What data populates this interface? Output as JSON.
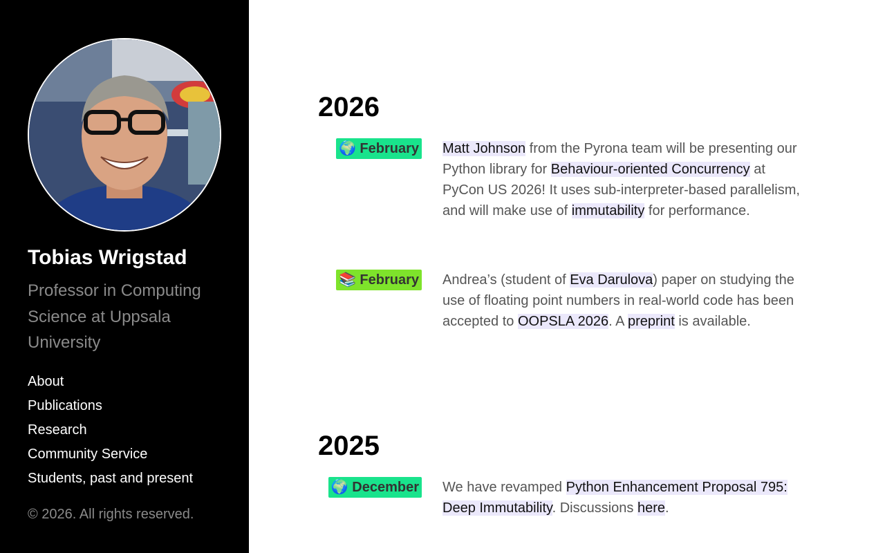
{
  "sidebar": {
    "name": "Tobias Wrigstad",
    "tagline": "Professor in Computing Science at Uppsala University",
    "nav": [
      {
        "label": "About"
      },
      {
        "label": "Publications"
      },
      {
        "label": "Research"
      },
      {
        "label": "Community Service"
      },
      {
        "label": "Students, past and present"
      }
    ],
    "copyright": "© 2026. All rights reserved."
  },
  "colors": {
    "badge_globe": "#19e38c",
    "badge_books": "#7ee32b",
    "link_highlight": "#ebe8fb"
  },
  "sections": [
    {
      "year": "2026",
      "items": [
        {
          "badge_icon": "🌍",
          "badge_icon_name": "globe-icon",
          "badge_month": "February",
          "parts": [
            {
              "text": "Matt Johnson",
              "link": true
            },
            {
              "text": " from the Pyrona team will be presenting our Python library for ",
              "link": false
            },
            {
              "text": "Behaviour-oriented Concurrency",
              "link": true
            },
            {
              "text": " at PyCon US 2026! It uses sub-interpreter-based parallelism, and will make use of ",
              "link": false
            },
            {
              "text": "immutability",
              "link": true
            },
            {
              "text": " for performance.",
              "link": false
            }
          ]
        },
        {
          "badge_icon": "📚",
          "badge_icon_name": "books-icon",
          "badge_month": "February",
          "parts": [
            {
              "text": "Andrea’s (student of ",
              "link": false
            },
            {
              "text": "Eva Darulova",
              "link": true
            },
            {
              "text": ") paper on studying the use of floating point numbers in real-world code has been accepted to ",
              "link": false
            },
            {
              "text": "OOPSLA 2026",
              "link": true
            },
            {
              "text": ". A ",
              "link": false
            },
            {
              "text": "preprint",
              "link": true
            },
            {
              "text": " is available.",
              "link": false
            }
          ]
        }
      ]
    },
    {
      "year": "2025",
      "items": [
        {
          "badge_icon": "🌍",
          "badge_icon_name": "globe-icon",
          "badge_month": "December",
          "parts": [
            {
              "text": "We have revamped ",
              "link": false
            },
            {
              "text": "Python Enhancement Proposal 795: Deep Immutability",
              "link": true
            },
            {
              "text": ". Discussions ",
              "link": false
            },
            {
              "text": "here",
              "link": true
            },
            {
              "text": ".",
              "link": false
            }
          ]
        }
      ]
    }
  ]
}
